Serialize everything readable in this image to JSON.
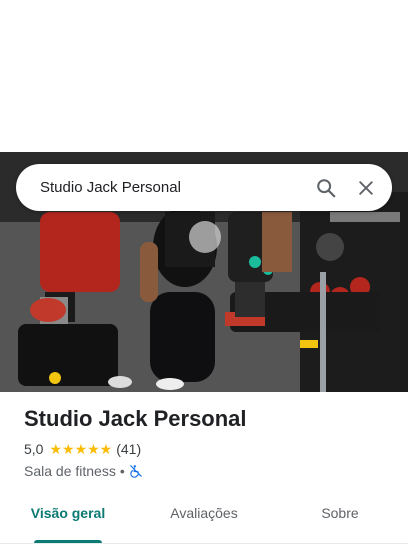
{
  "search": {
    "query": "Studio Jack Personal",
    "search_icon": "search-icon",
    "clear_icon": "close-icon"
  },
  "place": {
    "title": "Studio Jack Personal",
    "rating": "5,0",
    "stars": "★★★★★",
    "review_count": "(41)",
    "category": "Sala de fitness",
    "separator": "•",
    "accessibility_icon": "not-wheelchair-accessible-icon"
  },
  "tabs": [
    {
      "label": "Visão geral",
      "active": true
    },
    {
      "label": "Avaliações",
      "active": false
    },
    {
      "label": "Sobre",
      "active": false
    }
  ],
  "colors": {
    "accent": "#0b7a73",
    "star": "#fbbc04",
    "access_icon": "#1a73e8"
  }
}
